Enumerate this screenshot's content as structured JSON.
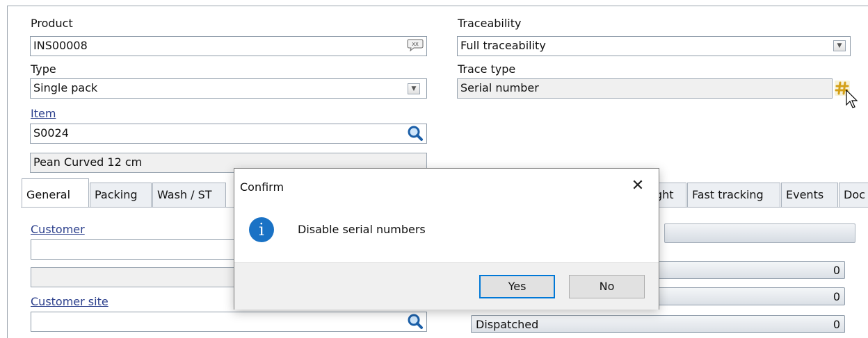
{
  "form": {
    "product_label": "Product",
    "product_value": "INS00008",
    "traceability_label": "Traceability",
    "traceability_value": "Full traceability",
    "type_label": "Type",
    "type_value": "Single pack",
    "trace_type_label": "Trace type",
    "trace_type_value": "Serial number",
    "item_label": "Item",
    "item_value": "S0024",
    "item_description": "Pean Curved 12 cm"
  },
  "tabs": [
    "General",
    "Packing",
    "Wash / ST",
    "ght",
    "Fast tracking",
    "Events",
    "Doc"
  ],
  "general": {
    "customer_label": "Customer",
    "customer_value": "",
    "customer_extra": "",
    "customer_site_label": "Customer site",
    "customer_site_value": ""
  },
  "status_rows": [
    {
      "label": "",
      "count": "0"
    },
    {
      "label": "",
      "count": "0"
    },
    {
      "label": "Dispatched",
      "count": "0"
    }
  ],
  "dialog": {
    "title": "Confirm",
    "close_glyph": "✕",
    "icon": "info-icon",
    "icon_glyph": "i",
    "message": "Disable serial numbers",
    "yes_label": "Yes",
    "no_label": "No"
  },
  "colors": {
    "link": "#2b3f8c",
    "info_icon": "#1a72c5",
    "default_button_border": "#0078d7"
  }
}
